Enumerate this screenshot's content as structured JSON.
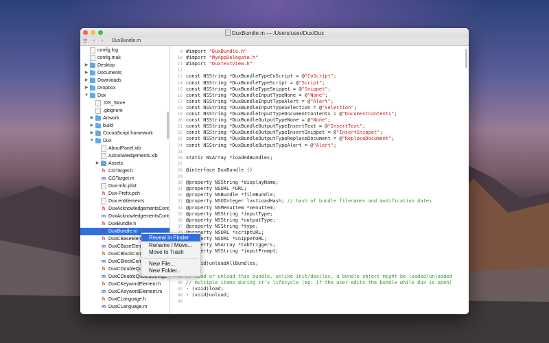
{
  "window": {
    "title": "DuxBundle.m — /Users/user/Dux/Dux",
    "tab_label": "DuxBundle.m",
    "close_color": "#fc605c",
    "min_color": "#fdbc40",
    "max_color": "#34c84a"
  },
  "sidebar": {
    "items": [
      {
        "label": "config.log",
        "type": "file",
        "indent": 0,
        "disclosure": ""
      },
      {
        "label": "config.mak",
        "type": "file",
        "indent": 0,
        "disclosure": ""
      },
      {
        "label": "Desktop",
        "type": "folder",
        "indent": 0,
        "disclosure": "▶"
      },
      {
        "label": "Documents",
        "type": "folder",
        "indent": 0,
        "disclosure": "▶"
      },
      {
        "label": "Downloads",
        "type": "folder",
        "indent": 0,
        "disclosure": "▶"
      },
      {
        "label": "Dropbox",
        "type": "folder",
        "indent": 0,
        "disclosure": "▶"
      },
      {
        "label": "Dux",
        "type": "folder",
        "indent": 0,
        "disclosure": "▼"
      },
      {
        "label": ".DS_Store",
        "type": "file",
        "indent": 1,
        "disclosure": ""
      },
      {
        "label": ".gitignore",
        "type": "file",
        "indent": 1,
        "disclosure": ""
      },
      {
        "label": "Artwork",
        "type": "folder",
        "indent": 1,
        "disclosure": "▶"
      },
      {
        "label": "build",
        "type": "folder",
        "indent": 1,
        "disclosure": "▶"
      },
      {
        "label": "CocoaScript.framework",
        "type": "folder",
        "indent": 1,
        "disclosure": "▶"
      },
      {
        "label": "Dux",
        "type": "folder",
        "indent": 1,
        "disclosure": "▼"
      },
      {
        "label": "AboutPanel.xib",
        "type": "file",
        "indent": 2,
        "disclosure": ""
      },
      {
        "label": "Acknowledgements.xib",
        "type": "file",
        "indent": 2,
        "disclosure": ""
      },
      {
        "label": "Assets",
        "type": "folder",
        "indent": 2,
        "disclosure": "▶"
      },
      {
        "label": "COTarget.h",
        "type": "h",
        "indent": 2,
        "disclosure": ""
      },
      {
        "label": "COTarget.m",
        "type": "m",
        "indent": 2,
        "disclosure": ""
      },
      {
        "label": "Dux-Info.plist",
        "type": "file",
        "indent": 2,
        "disclosure": ""
      },
      {
        "label": "Dux-Prefix.pch",
        "type": "h",
        "indent": 2,
        "disclosure": ""
      },
      {
        "label": "Dux.entitlements",
        "type": "file",
        "indent": 2,
        "disclosure": ""
      },
      {
        "label": "DuxAcknowledgementsCont",
        "type": "h",
        "indent": 2,
        "disclosure": ""
      },
      {
        "label": "DuxAcknowledgementsCont",
        "type": "m",
        "indent": 2,
        "disclosure": ""
      },
      {
        "label": "DuxBundle.h",
        "type": "h",
        "indent": 2,
        "disclosure": ""
      },
      {
        "label": "DuxBundle.m",
        "type": "m",
        "indent": 2,
        "disclosure": "",
        "selected": true
      },
      {
        "label": "DuxCBaseElemen",
        "type": "h",
        "indent": 2,
        "disclosure": ""
      },
      {
        "label": "DuxCBaseElemen",
        "type": "m",
        "indent": 2,
        "disclosure": ""
      },
      {
        "label": "DuxCBlockComm",
        "type": "h",
        "indent": 2,
        "disclosure": ""
      },
      {
        "label": "DuxCBlockComm",
        "type": "m",
        "indent": 2,
        "disclosure": ""
      },
      {
        "label": "DuxCDoubleQuo",
        "type": "h",
        "indent": 2,
        "disclosure": ""
      },
      {
        "label": "DuxCDoubleQuotedStringE",
        "type": "m",
        "indent": 2,
        "disclosure": ""
      },
      {
        "label": "DuxCKeywordElement.h",
        "type": "h",
        "indent": 2,
        "disclosure": ""
      },
      {
        "label": "DuxCKeywordElement.m",
        "type": "m",
        "indent": 2,
        "disclosure": ""
      },
      {
        "label": "DuxCLanguage.h",
        "type": "h",
        "indent": 2,
        "disclosure": ""
      },
      {
        "label": "DuxCLanguage.m",
        "type": "m",
        "indent": 2,
        "disclosure": ""
      }
    ]
  },
  "context_menu": {
    "items": [
      {
        "label": "Reveal in Finder",
        "highlighted": true
      },
      {
        "label": "Rename / Move..."
      },
      {
        "label": "Move to Trash"
      },
      {
        "separator": true
      },
      {
        "label": "New File..."
      },
      {
        "label": "New Folder..."
      }
    ]
  },
  "editor": {
    "lines": [
      {
        "n": "9",
        "code": [
          [
            "#import ",
            ""
          ],
          [
            "\"DuxBundle.h\"",
            "str"
          ]
        ]
      },
      {
        "n": "10",
        "code": [
          [
            "#import ",
            ""
          ],
          [
            "\"MyAppDelegate.h\"",
            "str"
          ]
        ]
      },
      {
        "n": "11",
        "code": [
          [
            "#import ",
            ""
          ],
          [
            "\"DuxTextView.h\"",
            "str"
          ]
        ]
      },
      {
        "n": "12",
        "code": []
      },
      {
        "n": "13",
        "code": [
          [
            "const NSString *DuxBundleTypeCoScript = @",
            ""
          ],
          [
            "\"CoScript\"",
            "str"
          ],
          [
            ";",
            ""
          ]
        ]
      },
      {
        "n": "14",
        "code": [
          [
            "const NSString *DuxBundleTypeScript = @",
            ""
          ],
          [
            "\"Script\"",
            "str"
          ],
          [
            ";",
            ""
          ]
        ]
      },
      {
        "n": "15",
        "code": [
          [
            "const NSString *DuxBundleTypeSnippet = @",
            ""
          ],
          [
            "\"Snippet\"",
            "str"
          ],
          [
            ";",
            ""
          ]
        ]
      },
      {
        "n": "16",
        "code": [
          [
            "const NSString *DuxBundleInputTypeNone = @",
            ""
          ],
          [
            "\"None\"",
            "str"
          ],
          [
            ";",
            ""
          ]
        ]
      },
      {
        "n": "17",
        "code": [
          [
            "const NSString *DuxBundleInputTypeAlert = @",
            ""
          ],
          [
            "\"Alert\"",
            "str"
          ],
          [
            ";",
            ""
          ]
        ]
      },
      {
        "n": "18",
        "code": [
          [
            "const NSString *DuxBundleInputTypeSelection = @",
            ""
          ],
          [
            "\"Selection\"",
            "str"
          ],
          [
            ";",
            ""
          ]
        ]
      },
      {
        "n": "19",
        "code": [
          [
            "const NSString *DuxBundleInputTypeDocumentContents = @",
            ""
          ],
          [
            "\"DocumentContents\"",
            "str"
          ],
          [
            ";",
            ""
          ]
        ]
      },
      {
        "n": "20",
        "code": [
          [
            "const NSString *DuxBundleOutputTypeNone = @",
            ""
          ],
          [
            "\"None\"",
            "str"
          ],
          [
            ";",
            ""
          ]
        ]
      },
      {
        "n": "21",
        "code": [
          [
            "const NSString *DuxBundleOutputTypeInsertText = @",
            ""
          ],
          [
            "\"InsertText\"",
            "str"
          ],
          [
            ";",
            ""
          ]
        ]
      },
      {
        "n": "22",
        "code": [
          [
            "const NSString *DuxBundleOutputTypeInsertSnippet = @",
            ""
          ],
          [
            "\"InsertSnippet\"",
            "str"
          ],
          [
            ";",
            ""
          ]
        ]
      },
      {
        "n": "23",
        "code": [
          [
            "const NSString *DuxBundleOutputTypeReplaceDocument = @",
            ""
          ],
          [
            "\"ReplaceDocument\"",
            "str"
          ],
          [
            ";",
            ""
          ]
        ]
      },
      {
        "n": "24",
        "code": [
          [
            "const NSString *DuxBundleOutputTypeAlert = @",
            ""
          ],
          [
            "\"Alert\"",
            "str"
          ],
          [
            ";",
            ""
          ]
        ]
      },
      {
        "n": "25",
        "code": []
      },
      {
        "n": "26",
        "code": [
          [
            "static NSArray *loadedBundles;",
            ""
          ]
        ]
      },
      {
        "n": "27",
        "code": []
      },
      {
        "n": "28",
        "code": [
          [
            "@interface DuxBundle ()",
            ""
          ]
        ]
      },
      {
        "n": "29",
        "code": []
      },
      {
        "n": "30",
        "code": [
          [
            "@property NSString *displayName;",
            ""
          ]
        ]
      },
      {
        "n": "31",
        "code": [
          [
            "@property NSURL *URL;",
            ""
          ]
        ]
      },
      {
        "n": "32",
        "code": [
          [
            "@property NSBundle *fileBundle;",
            ""
          ]
        ]
      },
      {
        "n": "33",
        "code": [
          [
            "@property NSUInteger lastLoadHash; ",
            ""
          ],
          [
            "// hash of bundle filenames and modification dates",
            "cmt"
          ]
        ]
      },
      {
        "n": "34",
        "code": [
          [
            "@property NSMenuItem *menuItem;",
            ""
          ]
        ]
      },
      {
        "n": "35",
        "code": [
          [
            "@property NSString *inputType;",
            ""
          ]
        ]
      },
      {
        "n": "36",
        "code": [
          [
            "@property NSString *outputType;",
            ""
          ]
        ]
      },
      {
        "n": "37",
        "code": [
          [
            "@property NSString *type;",
            ""
          ]
        ]
      },
      {
        "n": "38",
        "code": [
          [
            "@property NSURL *scriptURL;",
            ""
          ]
        ]
      },
      {
        "n": "39",
        "code": [
          [
            "@property NSURL *snippetURL;",
            ""
          ]
        ]
      },
      {
        "n": "40",
        "code": [
          [
            "@property NSArray *tabTriggers;",
            ""
          ]
        ]
      },
      {
        "n": "41",
        "code": [
          [
            "@property NSString *inputPrompt;",
            ""
          ]
        ]
      },
      {
        "n": "42",
        "code": []
      },
      {
        "n": "43",
        "code": [
          [
            "+ (void)unloadAllBundles;",
            ""
          ]
        ]
      },
      {
        "n": "44",
        "code": []
      },
      {
        "n": "45",
        "code": [
          [
            "// load or unload this bundle. unlike init/dealloc, a bundle object might be loaded/unloaded",
            "cmt"
          ]
        ]
      },
      {
        "n": "46",
        "code": [
          [
            "// multiple items during it's lifecycle (eg: if the user edits the bundle while dux is open)",
            "cmt"
          ]
        ]
      },
      {
        "n": "47",
        "code": [
          [
            "- (void)load;",
            ""
          ]
        ]
      },
      {
        "n": "48",
        "code": [
          [
            "- (void)unload;",
            ""
          ]
        ]
      },
      {
        "n": "49",
        "code": []
      }
    ]
  }
}
